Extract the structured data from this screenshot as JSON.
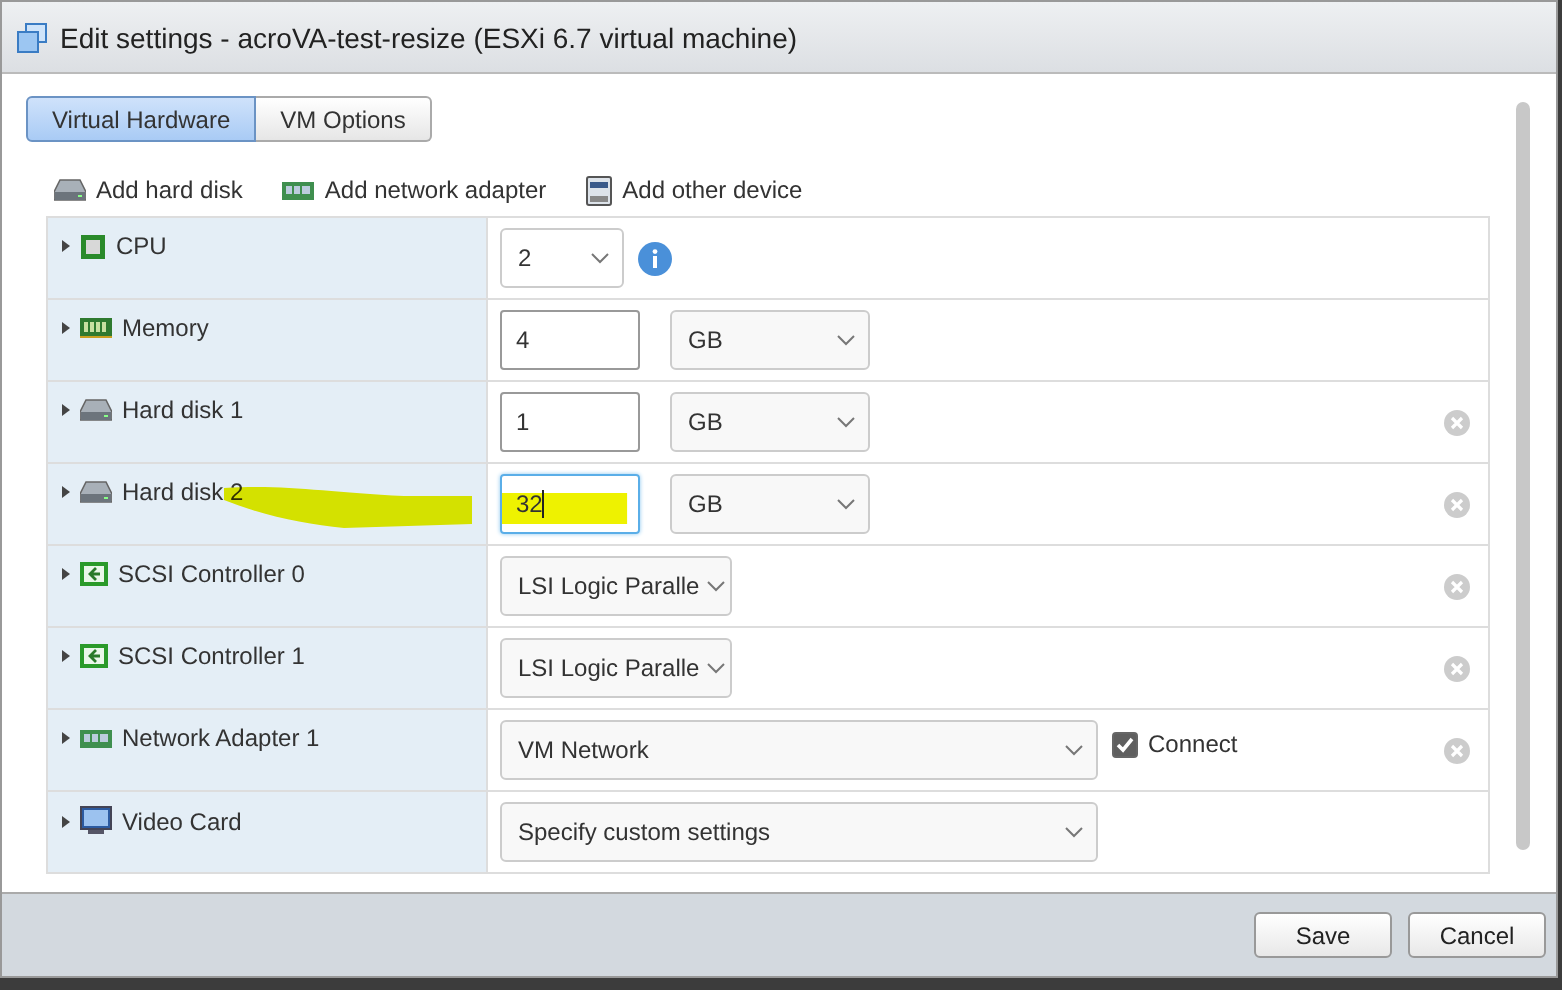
{
  "window": {
    "title": "Edit settings - acroVA-test-resize (ESXi 6.7 virtual machine)"
  },
  "tabs": [
    {
      "label": "Virtual Hardware",
      "selected": true
    },
    {
      "label": "VM Options",
      "selected": false
    }
  ],
  "toolbar": [
    {
      "kind": "disk",
      "label": "Add hard disk"
    },
    {
      "kind": "network",
      "label": "Add network adapter"
    },
    {
      "kind": "device",
      "label": "Add other device"
    }
  ],
  "devices": [
    {
      "kind": "cpu",
      "name": "CPU",
      "removable": false,
      "highlighted": false,
      "controls": [
        {
          "kind": "count_select",
          "value": "2"
        },
        {
          "kind": "info"
        }
      ]
    },
    {
      "kind": "memory",
      "name": "Memory",
      "removable": false,
      "highlighted": false,
      "controls": [
        {
          "kind": "size_input",
          "value": "4",
          "focused": false
        },
        {
          "kind": "unit_select",
          "value": "GB"
        }
      ]
    },
    {
      "kind": "disk",
      "name": "Hard disk 1",
      "removable": true,
      "highlighted": false,
      "controls": [
        {
          "kind": "size_input",
          "value": "1",
          "focused": false
        },
        {
          "kind": "unit_select",
          "value": "GB"
        }
      ]
    },
    {
      "kind": "disk",
      "name": "Hard disk 2",
      "removable": true,
      "highlighted": true,
      "controls": [
        {
          "kind": "size_input",
          "value": "32",
          "focused": true
        },
        {
          "kind": "unit_select",
          "value": "GB"
        }
      ]
    },
    {
      "kind": "scsi",
      "name": "SCSI Controller 0",
      "removable": true,
      "highlighted": false,
      "controls": [
        {
          "kind": "type_select",
          "value": "LSI Logic Paralle"
        }
      ]
    },
    {
      "kind": "scsi",
      "name": "SCSI Controller 1",
      "removable": true,
      "highlighted": false,
      "controls": [
        {
          "kind": "type_select",
          "value": "LSI Logic Paralle"
        }
      ]
    },
    {
      "kind": "network",
      "name": "Network Adapter 1",
      "removable": true,
      "highlighted": false,
      "controls": [
        {
          "kind": "wide_select",
          "value": "VM Network"
        },
        {
          "kind": "checkbox",
          "label": "Connect",
          "checked": true
        }
      ]
    },
    {
      "kind": "video",
      "name": "Video Card",
      "removable": false,
      "highlighted": false,
      "controls": [
        {
          "kind": "wide_select",
          "value": "Specify custom settings"
        }
      ]
    }
  ],
  "buttons": [
    {
      "label": "Save"
    },
    {
      "label": "Cancel"
    }
  ]
}
